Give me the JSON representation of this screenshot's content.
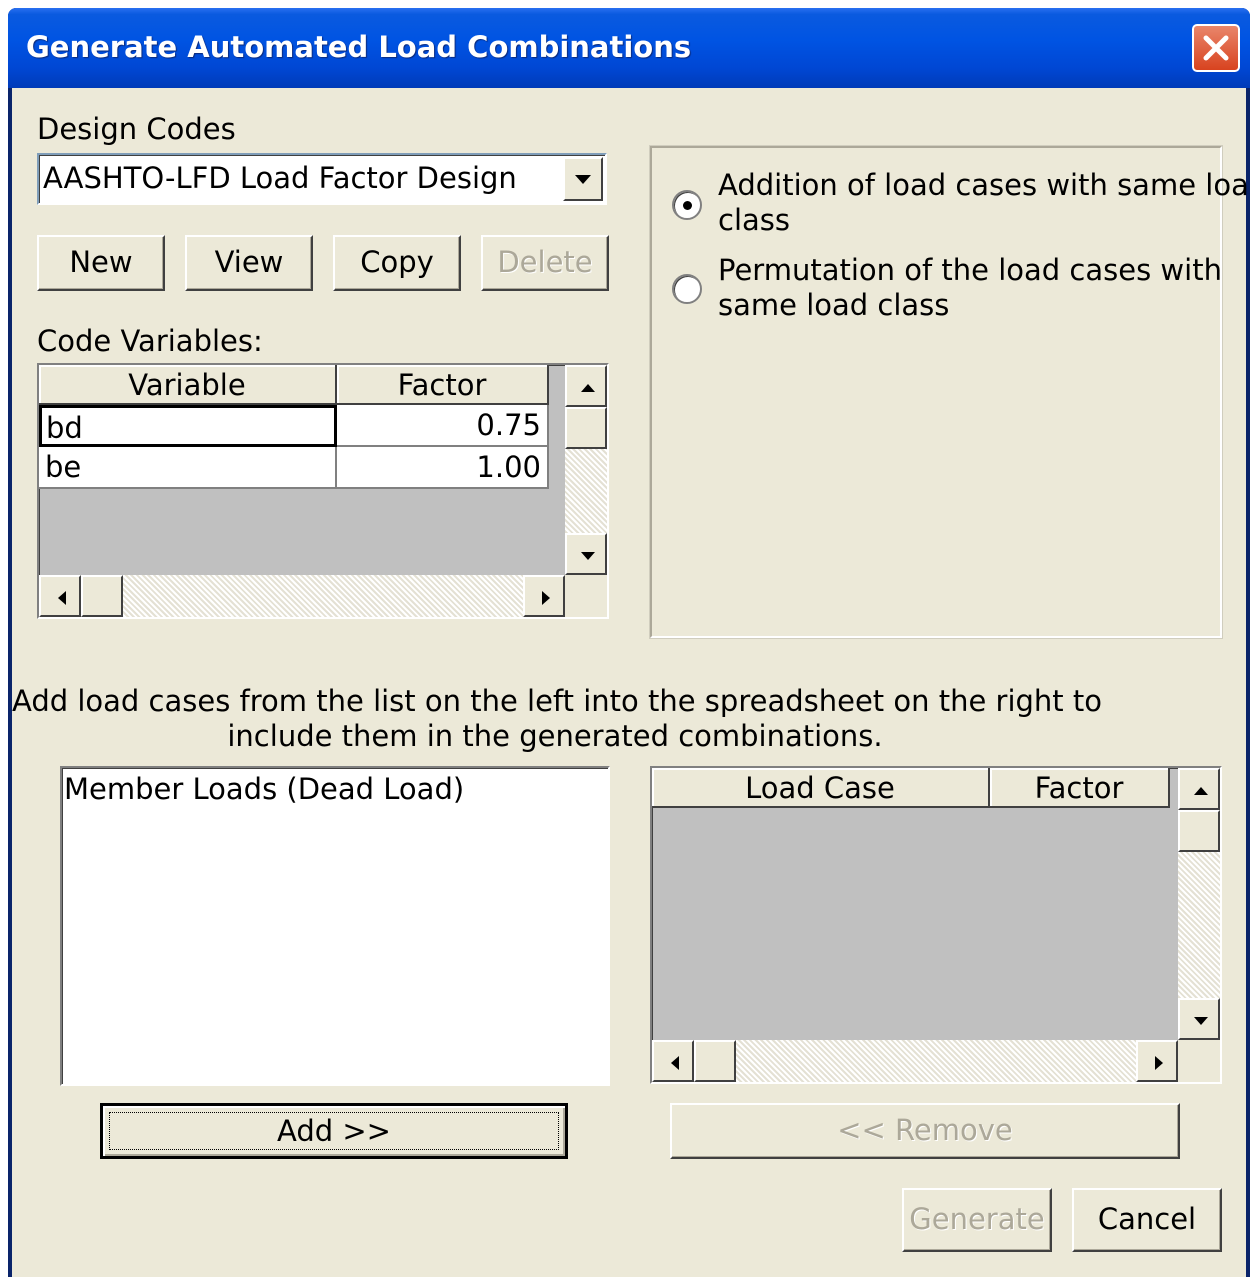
{
  "window": {
    "title": "Generate Automated Load Combinations"
  },
  "design_codes": {
    "label": "Design Codes",
    "selected": "AASHTO-LFD Load Factor Design"
  },
  "code_buttons": {
    "new": "New",
    "view": "View",
    "copy": "Copy",
    "delete": "Delete"
  },
  "code_variables": {
    "label": "Code Variables:",
    "columns": [
      "Variable",
      "Factor"
    ],
    "rows": [
      {
        "variable": "bd",
        "factor": "0.75"
      },
      {
        "variable": "be",
        "factor": "1.00"
      }
    ]
  },
  "options": {
    "addition_line1": "Addition of load cases with same load",
    "addition_line2": "class",
    "addition_selected": true,
    "permutation_line1": "Permutation of the load cases with",
    "permutation_line2": "same load class",
    "permutation_selected": false
  },
  "instructions": {
    "line1": "Add load cases from the list on the left into the spreadsheet on the right to",
    "line2": "include them in the generated combinations."
  },
  "load_case_list": {
    "items": [
      "Member Loads (Dead Load)"
    ]
  },
  "selected_cases": {
    "columns": [
      "Load Case",
      "Factor"
    ],
    "rows": []
  },
  "actions": {
    "add": "Add  >>",
    "remove": "<<  Remove",
    "generate": "Generate",
    "cancel": "Cancel"
  }
}
